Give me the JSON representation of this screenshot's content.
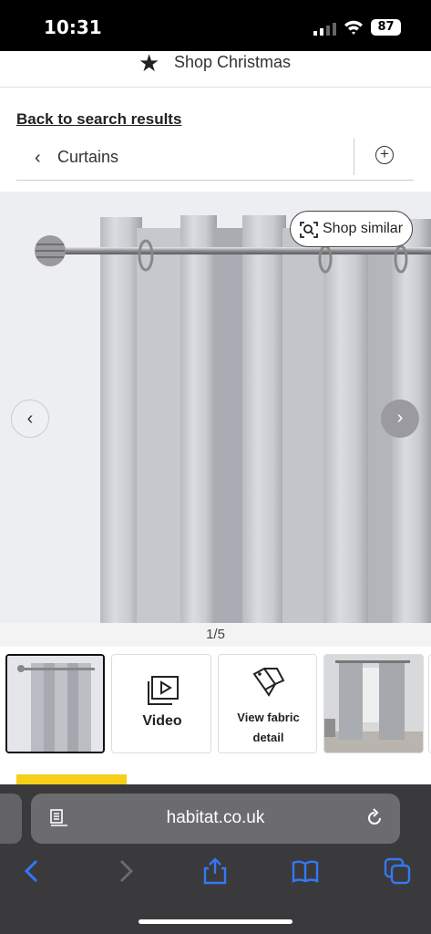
{
  "status": {
    "time": "10:31",
    "battery": "87"
  },
  "promo": {
    "label": "Shop Christmas",
    "icon": "star-icon"
  },
  "nav": {
    "back_label": "Back to search results",
    "crumb_label": "Curtains"
  },
  "gallery": {
    "shop_similar_label": "Shop similar",
    "counter": "1/5",
    "video_label": "Video",
    "fabric_label_1": "View fabric",
    "fabric_label_2": "detail"
  },
  "browser": {
    "host": "habitat.co.uk"
  },
  "colors": {
    "accent_yellow": "#f6cf1a",
    "link_blue": "#3478f6",
    "toolbar_bg": "#3a3a3c"
  }
}
